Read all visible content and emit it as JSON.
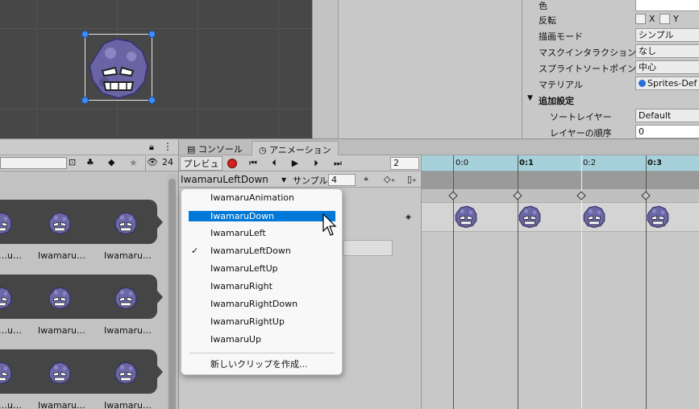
{
  "inspector": {
    "rows": [
      {
        "label": "色",
        "value": ""
      },
      {
        "label": "反転",
        "value": ""
      },
      {
        "label": "描画モード",
        "value": "シンプル"
      },
      {
        "label": "マスクインタラクション",
        "value": "なし"
      },
      {
        "label": "スプライトソートポイント",
        "value": "中心"
      },
      {
        "label": "マテリアル",
        "value": "Sprites-Def"
      }
    ],
    "flip_x": "X",
    "flip_y": "Y",
    "section": "追加設定",
    "sub_rows": [
      {
        "label": "ソートレイヤー",
        "value": "Default"
      },
      {
        "label": "レイヤーの順序",
        "value": "0"
      }
    ]
  },
  "project": {
    "count": "24",
    "tile_label": "Iwamaru…",
    "tile_label_short": "…u…"
  },
  "tabs": {
    "console": "コンソール",
    "animation": "アニメーション"
  },
  "anim_toolbar": {
    "preview": "プレビュー",
    "frame": "2",
    "clip": "IwamaruLeftDown",
    "sample_label": "サンプル",
    "sample_value": "4"
  },
  "timeline": {
    "ticks": [
      "0:0",
      "0:1",
      "0:2",
      "0:3"
    ]
  },
  "clip_menu": {
    "items": [
      {
        "label": "IwamaruAnimation"
      },
      {
        "label": "IwamaruDown"
      },
      {
        "label": "IwamaruLeft"
      },
      {
        "label": "IwamaruLeftDown"
      },
      {
        "label": "IwamaruLeftUp"
      },
      {
        "label": "IwamaruRight"
      },
      {
        "label": "IwamaruRightDown"
      },
      {
        "label": "IwamaruRightUp"
      },
      {
        "label": "IwamaruUp"
      }
    ],
    "create_new": "新しいクリップを作成...",
    "checkmark": "✓",
    "highlighted_index": 1,
    "checked_index": 3
  },
  "colors": {
    "highlight": "#0078d7",
    "handle": "#3c8cff",
    "scene_bg": "#474747",
    "timeline_header": "#a7d1da",
    "record": "#d32020"
  }
}
